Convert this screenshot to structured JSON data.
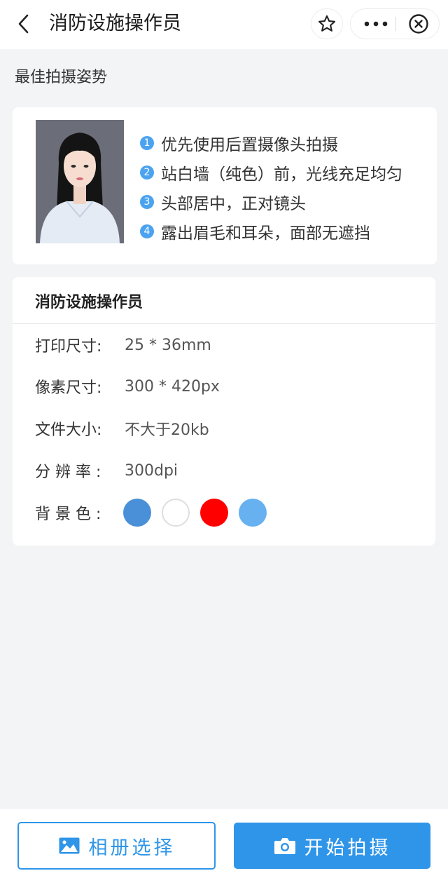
{
  "navbar": {
    "title": "消防设施操作员"
  },
  "posture": {
    "heading": "最佳拍摄姿势",
    "tips": [
      {
        "num": "1",
        "text": "优先使用后置摄像头拍摄"
      },
      {
        "num": "2",
        "text": "站白墙（纯色）前，光线充足均匀"
      },
      {
        "num": "3",
        "text": "头部居中，正对镜头"
      },
      {
        "num": "4",
        "text": "露出眉毛和耳朵，面部无遮挡"
      }
    ]
  },
  "spec": {
    "title": "消防设施操作员",
    "print_size": {
      "label": "打印尺寸:",
      "value": "25 * 36mm"
    },
    "pixel_size": {
      "label": "像素尺寸:",
      "value": "300 * 420px"
    },
    "file_size": {
      "label": "文件大小:",
      "value": "不大于20kb"
    },
    "resolution": {
      "label": "分辨率:",
      "value": "300dpi"
    },
    "background": {
      "label": "背景色:",
      "colors": [
        "#4a90d9",
        "#ffffff",
        "#ff0000",
        "#67b1f0"
      ]
    }
  },
  "actions": {
    "album_label": "相册选择",
    "shoot_label": "开始拍摄"
  },
  "theme": {
    "accent": "#2f95e8",
    "tip_badge": "#4ba3f0"
  }
}
